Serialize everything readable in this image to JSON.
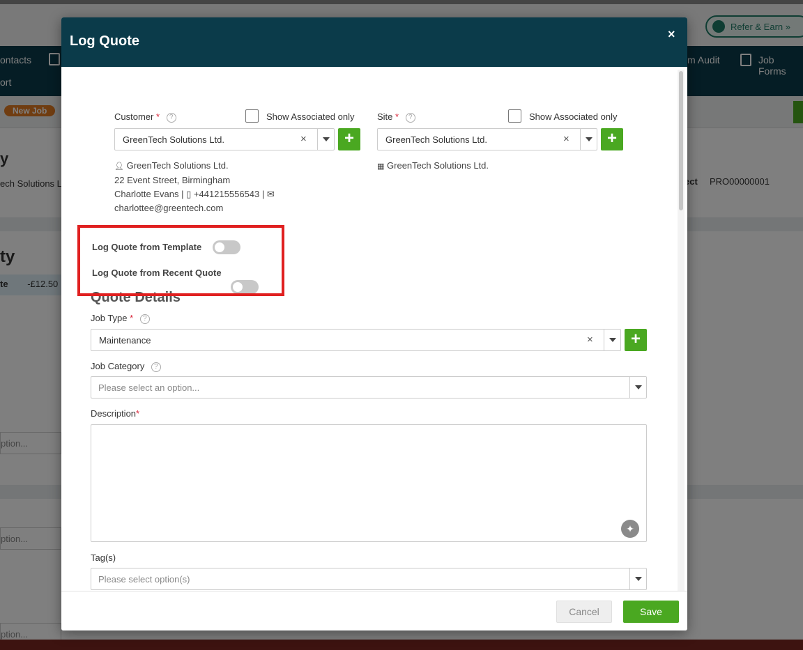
{
  "background": {
    "refer_label": "Refer & Earn »",
    "nav": {
      "contacts": "ontacts",
      "report": "ort",
      "audit": "m Audit",
      "job_forms": "Job Forms"
    },
    "new_job_badge": "New Job",
    "company_short": "ech Solutions L",
    "section_fragment_1": "y",
    "section_fragment_2": "ty",
    "quote_fragment": "te",
    "amount": "-£12.50",
    "project_label": "ect",
    "project_code": "PRO00000001",
    "option_fragment": "ption..."
  },
  "modal": {
    "title": "Log Quote",
    "close_icon": "×",
    "customer": {
      "label": "Customer",
      "required_mark": "*",
      "help_icon": "?",
      "show_associated_label": "Show Associated only",
      "value": "GreenTech Solutions Ltd.",
      "clear_icon": "×",
      "add_icon": "+",
      "address": {
        "name": "GreenTech Solutions Ltd.",
        "street": "22 Event Street, Birmingham",
        "contact": "Charlotte Evans",
        "phone": "+441215556543",
        "email": "charlottee@greentech.com"
      }
    },
    "site": {
      "label": "Site",
      "required_mark": "*",
      "help_icon": "?",
      "show_associated_label": "Show Associated only",
      "value": "GreenTech Solutions Ltd.",
      "clear_icon": "×",
      "add_icon": "+",
      "address_name": "GreenTech Solutions Ltd."
    },
    "toggles": {
      "template_label": "Log Quote from Template",
      "recent_label": "Log Quote from Recent Quote"
    },
    "quote_details_title": "Quote Details",
    "job_type": {
      "label": "Job Type",
      "required_mark": "*",
      "help_icon": "?",
      "value": "Maintenance",
      "clear_icon": "×",
      "add_icon": "+"
    },
    "job_category": {
      "label": "Job Category",
      "help_icon": "?",
      "placeholder": "Please select an option..."
    },
    "description": {
      "label": "Description",
      "required_mark": "*",
      "value": ""
    },
    "tags": {
      "label": "Tag(s)",
      "placeholder": "Please select option(s)"
    },
    "footer": {
      "cancel_label": "Cancel",
      "save_label": "Save"
    }
  }
}
